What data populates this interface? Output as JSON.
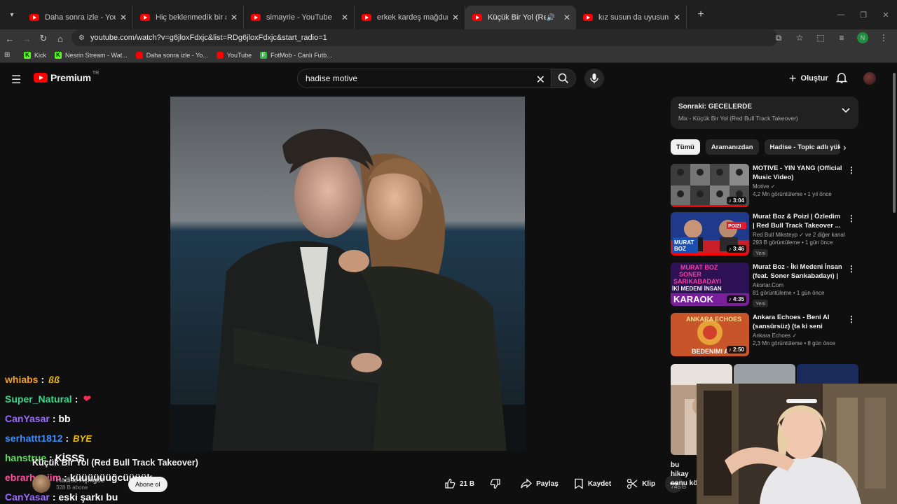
{
  "browser": {
    "tabs": [
      {
        "title": "Daha sonra izle - YouTube",
        "active": false
      },
      {
        "title": "Hiç beklenmedik bir anda gele",
        "active": false
      },
      {
        "title": "simayrie - YouTube",
        "active": false
      },
      {
        "title": "erkek kardeş mağdurları kişisel",
        "active": false
      },
      {
        "title": "Küçük Bir Yol (Red Bull Track",
        "active": true
      },
      {
        "title": "kız susun da uyusun #bayram",
        "active": false
      }
    ],
    "url": "youtube.com/watch?v=g6jloxFdxjc&list=RDg6jloxFdxjc&start_radio=1",
    "profile_initial": "N",
    "bookmarks": [
      {
        "label": "Kick",
        "icon": "kick-icon"
      },
      {
        "label": "Nesrin Stream - Wat...",
        "icon": "kick-icon"
      },
      {
        "label": "Daha sonra izle - Yo...",
        "icon": "youtube-icon"
      },
      {
        "label": "YouTube",
        "icon": "youtube-icon"
      },
      {
        "label": "FotMob - Canlı Futb...",
        "icon": "fotmob-icon"
      }
    ]
  },
  "youtube": {
    "logo_text": "Premium",
    "country_code": "TR",
    "search_query": "hadise motive",
    "create_label": "Oluştur"
  },
  "video": {
    "title": "Küçük Bir Yol (Red Bull Track Takeover)",
    "channel": "Hadise Açıkgöz",
    "subscribers": "328 B abone",
    "subscribe_label": "Abone ol",
    "likes": "21 B",
    "share_label": "Paylaş",
    "save_label": "Kaydet",
    "clip_label": "Klip"
  },
  "chat": [
    {
      "user": "whiabs",
      "color": "#f0a020",
      "message": "",
      "emote": "ßß",
      "emote_color": "#f0c000"
    },
    {
      "user": "Super_Natural",
      "color": "#3dd68c",
      "message": "",
      "emote": "❤",
      "emote_color": "#ff2d55"
    },
    {
      "user": "CanYasar",
      "color": "#9a6cff",
      "message": "bb",
      "emote": "",
      "emote_color": ""
    },
    {
      "user": "serhattt1812",
      "color": "#3a8fff",
      "message": "",
      "emote": "BYE",
      "emote_color": "#f0c000"
    },
    {
      "user": "hanstrue",
      "color": "#5ee05e",
      "message": "KİSSS",
      "emote": "",
      "emote_color": ""
    },
    {
      "user": "ebrarhaniim",
      "color": "#ff4fa0",
      "message": "küüüüüüğcüüüük",
      "emote": "",
      "emote_color": ""
    },
    {
      "user": "CanYasar",
      "color": "#9a6cff",
      "message": "eski şarkı bu",
      "emote": "",
      "emote_color": ""
    }
  ],
  "sidebar": {
    "up_next_title": "Sonraki: GECELERDE",
    "up_next_subtitle": "Mix - Küçük Bir Yol (Red Bull Track Takeover)",
    "chips": [
      "Tümü",
      "Aramanızdan",
      "Hadise - Topic adlı yükle"
    ],
    "recommendations": [
      {
        "title": "MOTIVE - YIN YANG (Official Music Video)",
        "channel": "Motive ✓",
        "meta": "4,2 Mn görüntüleme • 1 yıl önce",
        "duration": "3:04",
        "badge": "",
        "progress": 1.0
      },
      {
        "title": "Murat Boz & Poizi | Özledim | Red Bull Track Takeover ...",
        "channel": "Red Bull Miksteyp ✓ ve 2 diğer kanal",
        "meta": "293 B görüntüleme • 1 gün önce",
        "duration": "3:46",
        "badge": "Yeni",
        "progress": 1.0
      },
      {
        "title": "Murat Boz - İki Medeni İnsan (feat. Soner Sarıkabadayı) | ...",
        "channel": "Akorlar.Com",
        "meta": "81 görüntüleme • 1 gün önce",
        "duration": "4:35",
        "badge": "Yeni",
        "progress": 0
      },
      {
        "title": "Ankara Echoes - Beni Al (sansürsüz) (ta ki seni görene ...",
        "channel": "Ankara Echoes ✓",
        "meta": "2,3 Mn görüntüleme • 8 gün önce",
        "duration": "2:50",
        "badge": "",
        "progress": 0
      }
    ],
    "short_title": "bu hikay sonu kö",
    "short_views": "745 B"
  }
}
